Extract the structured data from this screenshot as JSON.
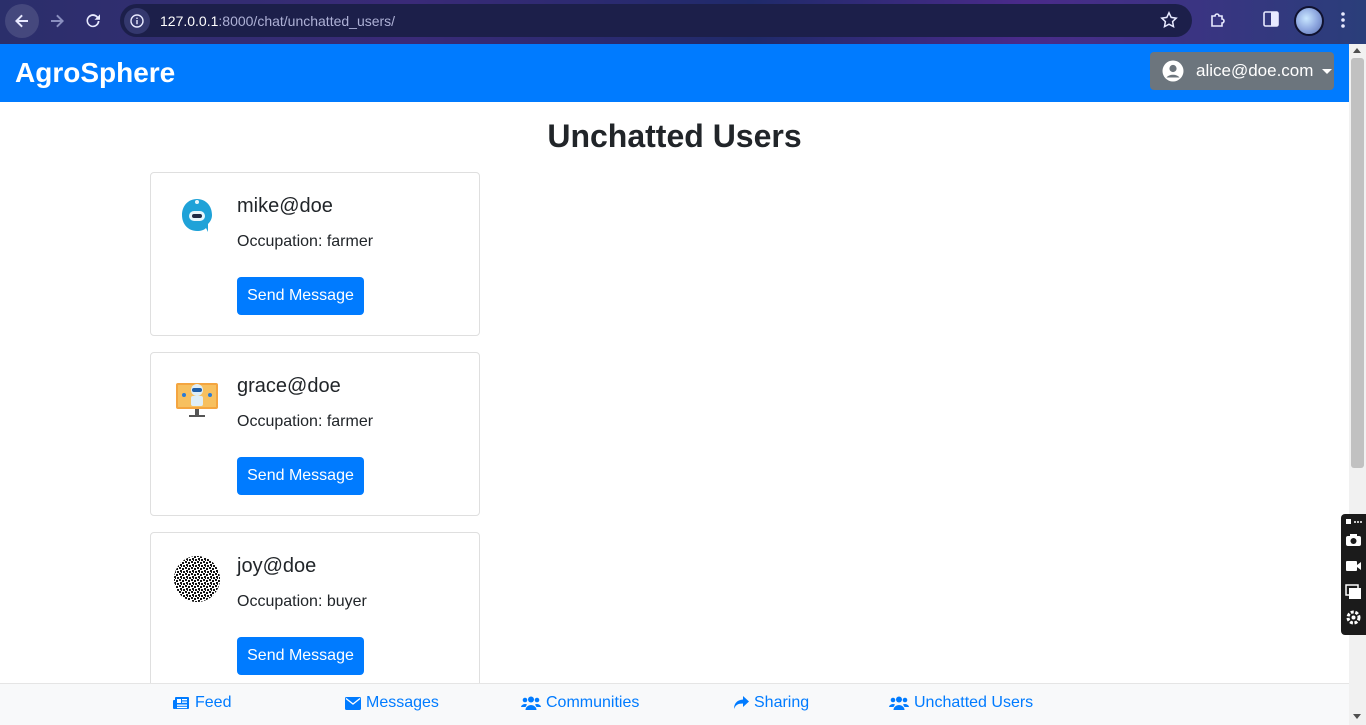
{
  "browser": {
    "url_host": "127.0.0.1",
    "url_path": ":8000/chat/unchatted_users/"
  },
  "navbar": {
    "brand": "AgroSphere",
    "user_email": "alice@doe.com"
  },
  "page": {
    "title": "Unchatted Users"
  },
  "users": [
    {
      "name": "mike@doe",
      "occupation": "Occupation: farmer",
      "button": "Send Message"
    },
    {
      "name": "grace@doe",
      "occupation": "Occupation: farmer",
      "button": "Send Message"
    },
    {
      "name": "joy@doe",
      "occupation": "Occupation: buyer",
      "button": "Send Message"
    }
  ],
  "bottom_nav": {
    "feed": "Feed",
    "messages": "Messages",
    "communities": "Communities",
    "sharing": "Sharing",
    "unchatted": "Unchatted Users"
  },
  "colors": {
    "primary": "#007bff",
    "secondary": "#6c757d",
    "text": "#212529"
  }
}
